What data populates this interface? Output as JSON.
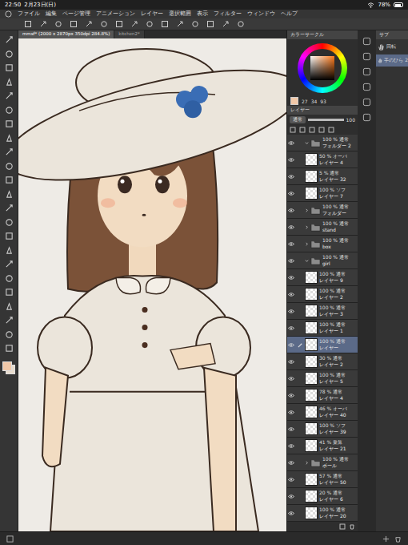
{
  "status_bar": {
    "time": "22:50",
    "date": "2月23日(日)",
    "battery": "78%"
  },
  "menu": [
    "ファイル",
    "編集",
    "ページ管理",
    "アニメーション",
    "レイヤー",
    "選択範囲",
    "表示",
    "フィルター",
    "ウィンドウ",
    "ヘルプ"
  ],
  "tabs": [
    {
      "label": "mmsf* (2000 x 2870px 350dpi 284.8%)",
      "selected": true
    },
    {
      "label": "kitchen2*",
      "selected": false
    }
  ],
  "color_panel": {
    "title": "カラーサークル",
    "values": [
      "27",
      "34",
      "93"
    ]
  },
  "layer_panel": {
    "title": "レイヤー",
    "blend": "通常",
    "opacity": "100",
    "layers": [
      {
        "opacity": "100 %",
        "mode": "通常",
        "name": "フォルダー 2",
        "kind": "folder",
        "expanded": true,
        "visible": true,
        "selected": false
      },
      {
        "opacity": "50 %",
        "mode": "オーバ",
        "name": "レイヤー 4",
        "kind": "layer",
        "expanded": false,
        "visible": true,
        "selected": false
      },
      {
        "opacity": "5 %",
        "mode": "通常",
        "name": "レイヤー 32",
        "kind": "layer",
        "expanded": false,
        "visible": true,
        "selected": false
      },
      {
        "opacity": "100 %",
        "mode": "ソフ",
        "name": "レイヤー 7",
        "kind": "layer",
        "expanded": false,
        "visible": true,
        "selected": false
      },
      {
        "opacity": "100 %",
        "mode": "通常",
        "name": "フォルダー",
        "kind": "folder",
        "expanded": false,
        "visible": true,
        "selected": false
      },
      {
        "opacity": "100 %",
        "mode": "通常",
        "name": "stand",
        "kind": "folder",
        "expanded": false,
        "visible": true,
        "selected": false
      },
      {
        "opacity": "100 %",
        "mode": "通常",
        "name": "box",
        "kind": "folder",
        "expanded": false,
        "visible": true,
        "selected": false
      },
      {
        "opacity": "100 %",
        "mode": "通常",
        "name": "girl",
        "kind": "folder",
        "expanded": true,
        "visible": true,
        "selected": false
      },
      {
        "opacity": "100 %",
        "mode": "通常",
        "name": "レイヤー 9",
        "kind": "layer",
        "expanded": false,
        "visible": true,
        "selected": false
      },
      {
        "opacity": "100 %",
        "mode": "通常",
        "name": "レイヤー 2",
        "kind": "layer",
        "expanded": false,
        "visible": true,
        "selected": false
      },
      {
        "opacity": "100 %",
        "mode": "通常",
        "name": "レイヤー 3",
        "kind": "layer",
        "expanded": false,
        "visible": true,
        "selected": false
      },
      {
        "opacity": "100 %",
        "mode": "通常",
        "name": "レイヤー 1",
        "kind": "layer",
        "expanded": false,
        "visible": true,
        "selected": false
      },
      {
        "opacity": "100 %",
        "mode": "通常",
        "name": "レイヤー",
        "kind": "layer",
        "expanded": false,
        "visible": true,
        "selected": true
      },
      {
        "opacity": "30 %",
        "mode": "通常",
        "name": "レイヤー 2",
        "kind": "layer",
        "expanded": false,
        "visible": true,
        "selected": false
      },
      {
        "opacity": "100 %",
        "mode": "通常",
        "name": "レイヤー 5",
        "kind": "layer",
        "expanded": false,
        "visible": true,
        "selected": false
      },
      {
        "opacity": "78 %",
        "mode": "通常",
        "name": "レイヤー 4",
        "kind": "layer",
        "expanded": false,
        "visible": true,
        "selected": false
      },
      {
        "opacity": "46 %",
        "mode": "オーバ",
        "name": "レイヤー 40",
        "kind": "layer",
        "expanded": false,
        "visible": true,
        "selected": false
      },
      {
        "opacity": "100 %",
        "mode": "ソフ",
        "name": "レイヤー 39",
        "kind": "layer",
        "expanded": false,
        "visible": true,
        "selected": false
      },
      {
        "opacity": "41 %",
        "mode": "乗算",
        "name": "レイヤー 21",
        "kind": "layer",
        "expanded": false,
        "visible": true,
        "selected": false
      },
      {
        "opacity": "100 %",
        "mode": "通常",
        "name": "ボール",
        "kind": "folder",
        "expanded": false,
        "visible": true,
        "selected": false
      },
      {
        "opacity": "57 %",
        "mode": "通常",
        "name": "レイヤー 50",
        "kind": "layer",
        "expanded": false,
        "visible": true,
        "selected": false
      },
      {
        "opacity": "20 %",
        "mode": "通常",
        "name": "レイヤー 6",
        "kind": "layer",
        "expanded": false,
        "visible": true,
        "selected": false
      },
      {
        "opacity": "100 %",
        "mode": "通常",
        "name": "レイヤー 20",
        "kind": "layer",
        "expanded": false,
        "visible": true,
        "selected": false
      }
    ]
  },
  "sub_panel": {
    "title": "サブ",
    "items": [
      {
        "label": "回転",
        "selected": false
      },
      {
        "label": "手のひら 2",
        "selected": true
      }
    ]
  }
}
